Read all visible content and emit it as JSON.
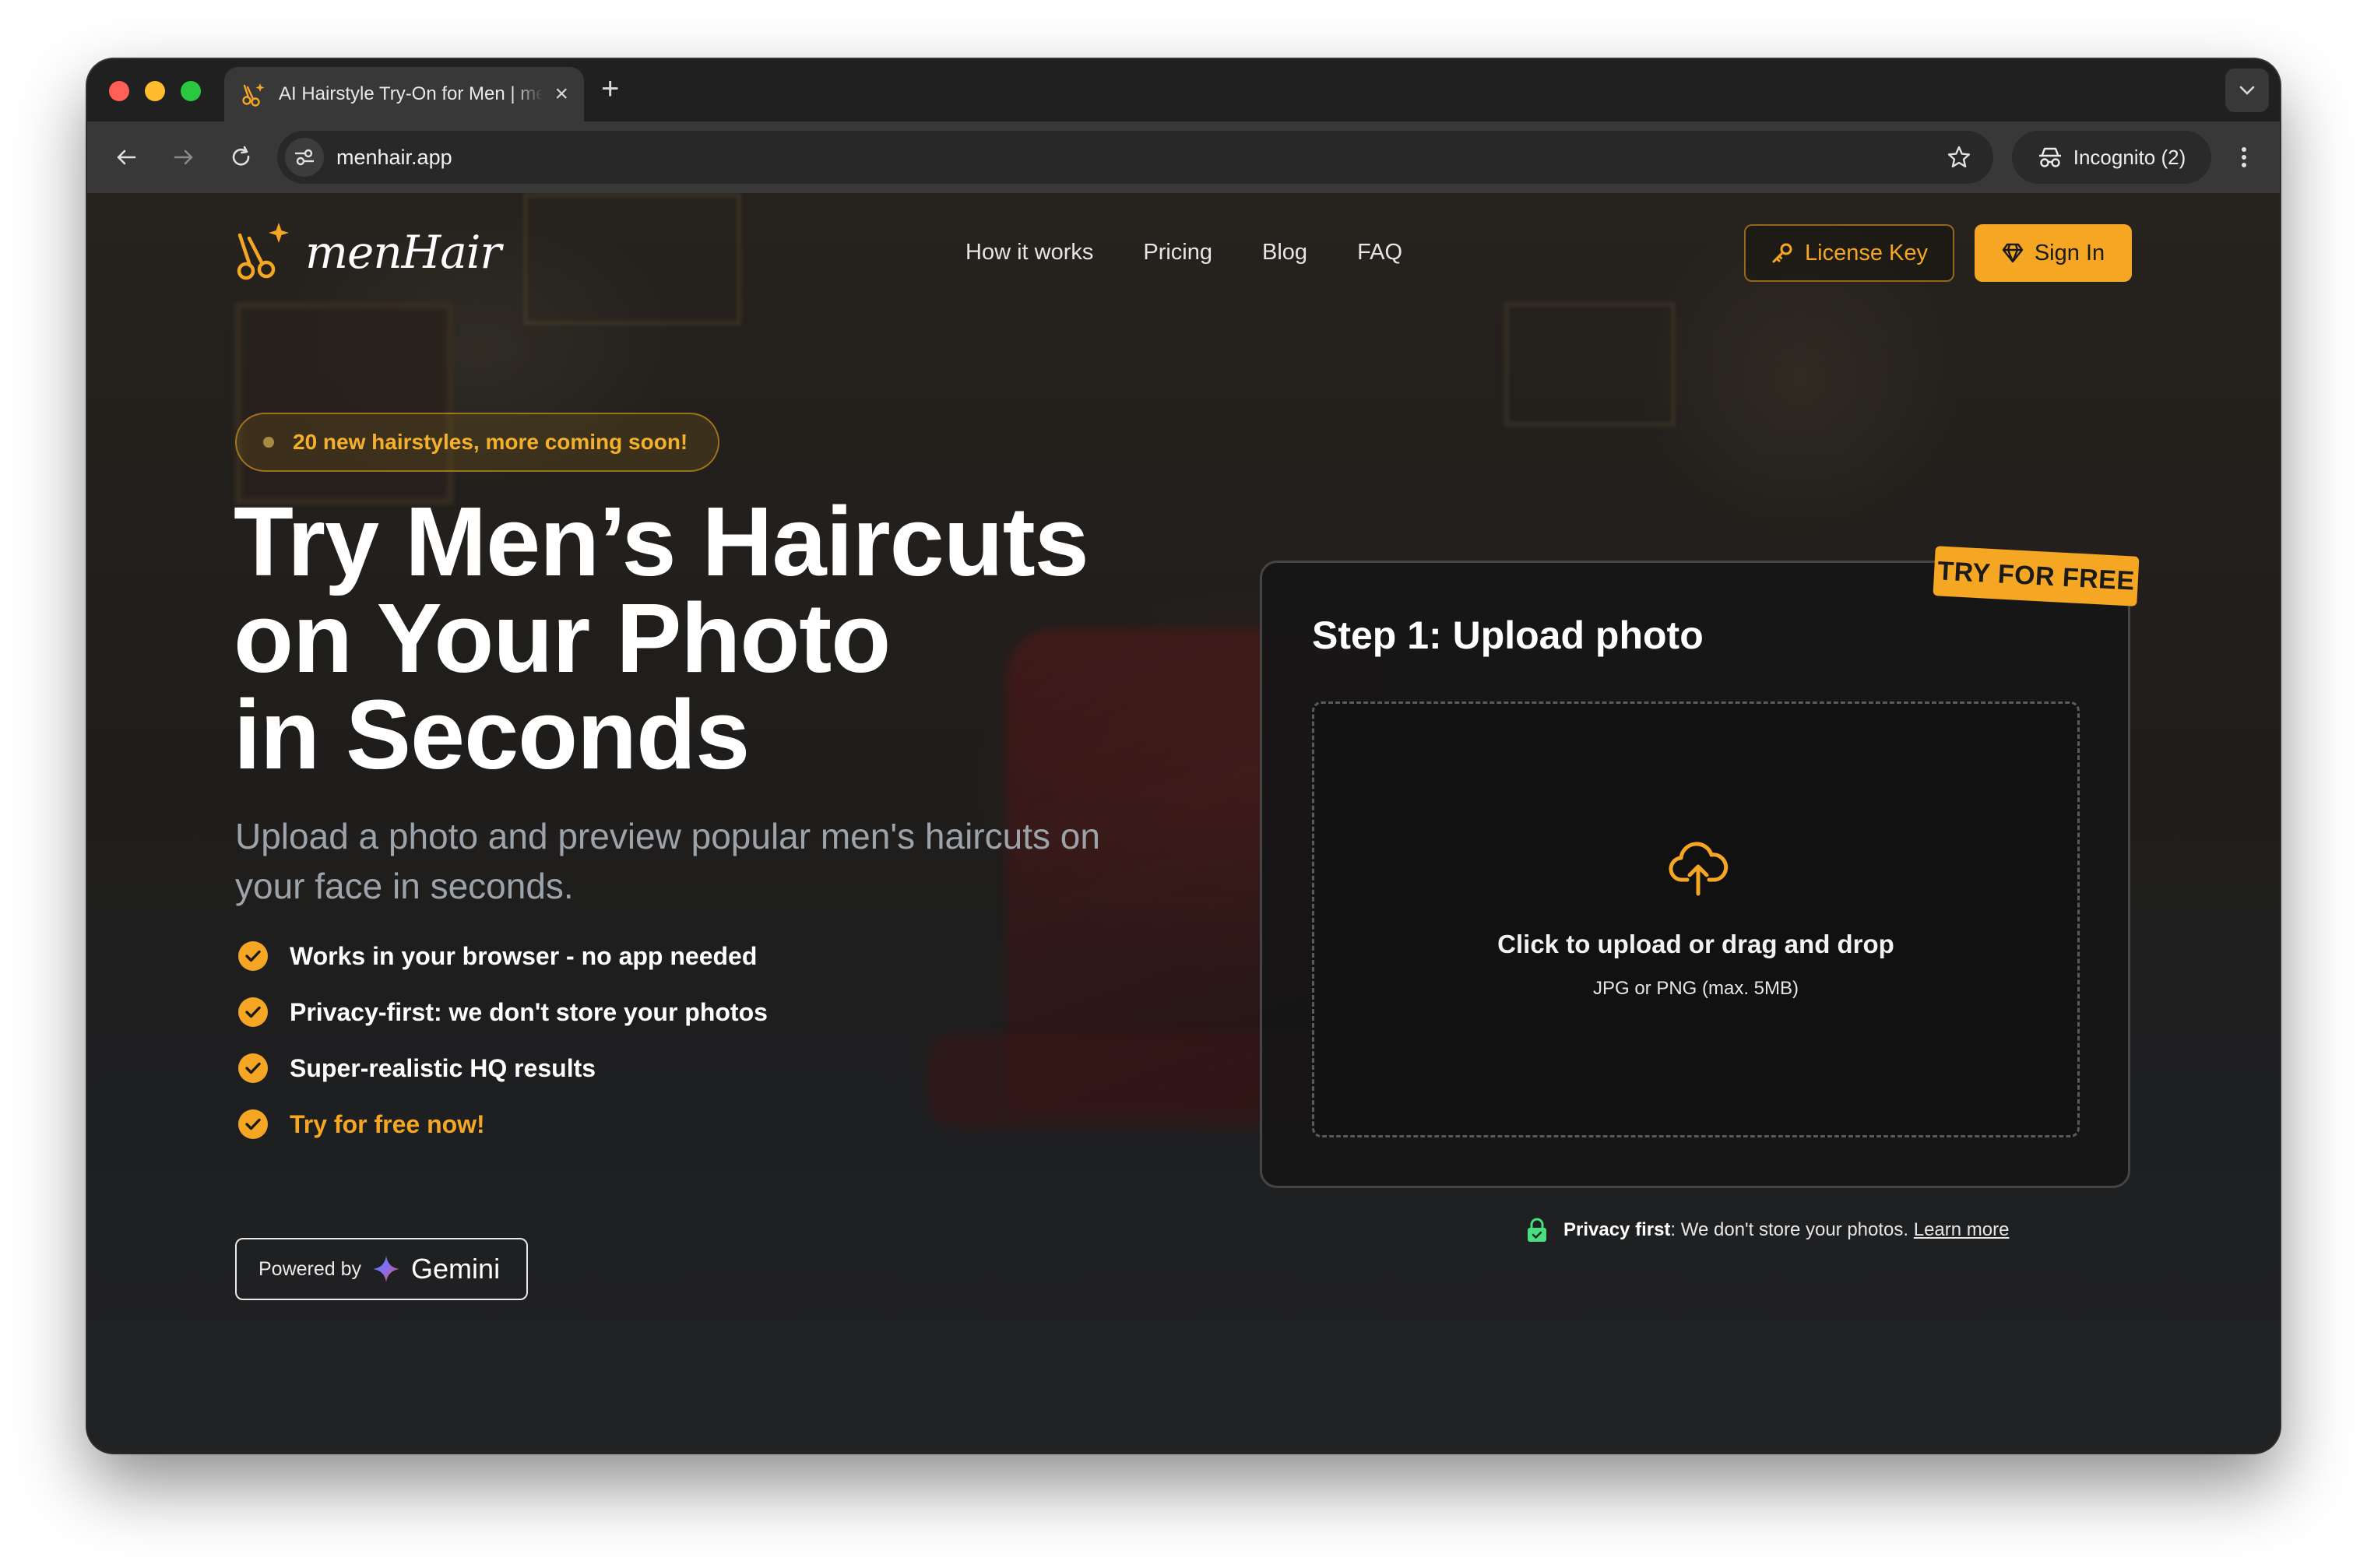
{
  "browser": {
    "tab_title": "AI Hairstyle Try-On for Men | menHair",
    "url": "menhair.app",
    "incognito_label": "Incognito (2)",
    "icons": [
      "back-arrow-icon",
      "forward-arrow-icon",
      "reload-icon",
      "site-info-icon",
      "star-icon",
      "incognito-icon",
      "kebab-menu-icon",
      "tab-list-chevron-icon"
    ]
  },
  "header": {
    "logo_text": "menHair",
    "nav": [
      "How it works",
      "Pricing",
      "Blog",
      "FAQ"
    ],
    "license_key_label": "License Key",
    "sign_in_label": "Sign In"
  },
  "hero": {
    "badge": "20 new hairstyles, more coming soon!",
    "title_line1": "Try Men’s Haircuts",
    "title_line2": "on Your Photo",
    "title_line3": "in Seconds",
    "subtitle": "Upload a photo and preview popular men's haircuts on your face in seconds.",
    "features": [
      "Works in your browser - no app needed",
      "Privacy-first: we don't store your photos",
      "Super-realistic HQ results",
      "Try for free now!"
    ],
    "powered_by_label": "Powered by",
    "powered_by_brand": "Gemini"
  },
  "upload": {
    "ribbon": "TRY FOR FREE",
    "step_title": "Step 1: Upload photo",
    "dropzone_title": "Click to upload or drag and drop",
    "dropzone_hint": "JPG or PNG (max. 5MB)",
    "privacy_bold": "Privacy first",
    "privacy_text": ": We don't store your photos.",
    "privacy_link": "Learn more"
  },
  "colors": {
    "accent": "#f5a623",
    "page_bg": "#212224",
    "privacy_lock": "#4ade80"
  }
}
